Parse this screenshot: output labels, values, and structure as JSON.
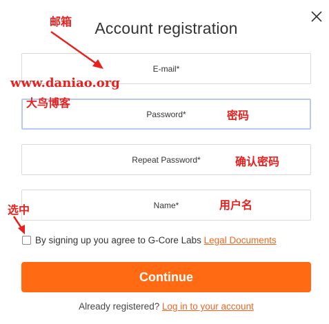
{
  "dialog": {
    "title": "Account registration",
    "close_icon": "close-icon"
  },
  "form": {
    "email_label": "E-mail*",
    "password_label": "Password*",
    "repeat_password_label": "Repeat Password*",
    "name_label": "Name*",
    "agree_text": "By signing up you agree to G-Core Labs ",
    "agree_link": "Legal Documents",
    "continue_label": "Continue",
    "already_text": "Already registered? ",
    "login_link": "Log in to your account"
  },
  "annotations": {
    "mail": "邮箱",
    "site": "www.daniao.org",
    "blog": "大鸟博客",
    "password": "密码",
    "confirm_password": "确认密码",
    "username": "用户名",
    "select": "选中"
  },
  "colors": {
    "accent": "#ff6a13",
    "annotation": "#e8201e",
    "link": "#f5641e"
  }
}
